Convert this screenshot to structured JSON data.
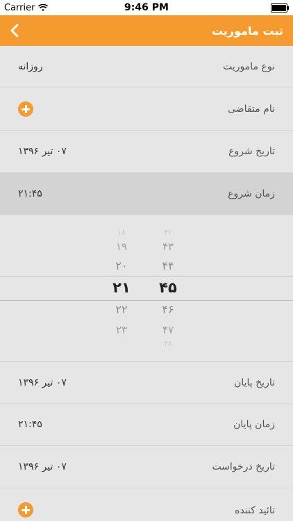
{
  "status_bar": {
    "carrier": "Carrier",
    "time": "9:46 PM"
  },
  "nav": {
    "title": "ثبت ماموریت",
    "back_icon": "chevron-left-icon"
  },
  "rows_top": [
    {
      "label": "نوع ماموریت",
      "value": "روزانه"
    },
    {
      "label": "نام متقاضی",
      "value": ""
    },
    {
      "label": "تاریخ شروع",
      "value": "۰۷ تیر ۱۳۹۶"
    },
    {
      "label": "زمان شروع",
      "value": "۲۱:۴۵"
    }
  ],
  "picker": {
    "hours": [
      "۱۸",
      "۱۹",
      "۲۰",
      "۲۱",
      "۲۲",
      "۲۳",
      "۰"
    ],
    "minutes": [
      "۴۲",
      "۴۳",
      "۴۴",
      "۴۵",
      "۴۶",
      "۴۷",
      "۴۸"
    ],
    "selected_index": 3
  },
  "rows_bottom": [
    {
      "label": "تاریخ پایان",
      "value": "۰۷ تیر ۱۳۹۶"
    },
    {
      "label": "زمان پایان",
      "value": "۲۱:۴۵"
    },
    {
      "label": "تاریخ درخواست",
      "value": "۰۷ تیر ۱۳۹۶"
    },
    {
      "label": "تائید کننده",
      "value": ""
    }
  ],
  "colors": {
    "accent": "#f59a2f",
    "background": "#e6e6e6",
    "selected_row": "#d3d3d3"
  }
}
